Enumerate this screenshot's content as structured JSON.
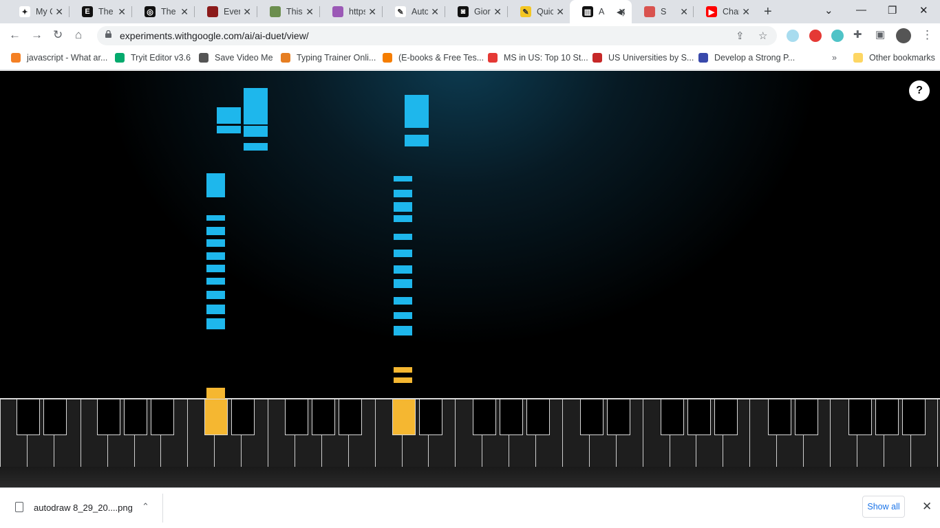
{
  "browser": {
    "tabs": [
      {
        "title": "My C",
        "favicon_color": "#fff",
        "favicon_text": "✦",
        "favicon_fg": "#222"
      },
      {
        "title": "The I",
        "favicon_color": "#111",
        "favicon_text": "E",
        "favicon_fg": "#fff"
      },
      {
        "title": "The I",
        "favicon_color": "#111",
        "favicon_text": "◎",
        "favicon_fg": "#fff"
      },
      {
        "title": "Even",
        "favicon_color": "#8b1a1a",
        "favicon_text": "",
        "favicon_fg": "#fff"
      },
      {
        "title": "This I",
        "favicon_color": "#6b8e4e",
        "favicon_text": "",
        "favicon_fg": "#fff"
      },
      {
        "title": "https",
        "favicon_color": "#9b59b6",
        "favicon_text": "",
        "favicon_fg": "#fff"
      },
      {
        "title": "Auto",
        "favicon_color": "#fff",
        "favicon_text": "✎",
        "favicon_fg": "#333"
      },
      {
        "title": "Giorg",
        "favicon_color": "#111",
        "favicon_text": "◙",
        "favicon_fg": "#fff"
      },
      {
        "title": "Quic",
        "favicon_color": "#f3c623",
        "favicon_text": "✎",
        "favicon_fg": "#333"
      },
      {
        "title": "A",
        "favicon_color": "#111",
        "favicon_text": "▥",
        "favicon_fg": "#fff"
      },
      {
        "title": "S",
        "favicon_color": "#d9534f",
        "favicon_text": "",
        "favicon_fg": "#fff"
      },
      {
        "title": "Chan",
        "favicon_color": "#ff0000",
        "favicon_text": "▶",
        "favicon_fg": "#fff"
      }
    ],
    "active_tab_index": 9,
    "url": "experiments.withgoogle.com/ai/ai-duet/view/",
    "bookmarks": [
      {
        "label": "javascript - What ar...",
        "color": "#f48024"
      },
      {
        "label": "Tryit Editor v3.6",
        "color": "#04aa6d"
      },
      {
        "label": "Save Video Me",
        "color": "#555555"
      },
      {
        "label": "Typing Trainer Onli...",
        "color": "#e67e22"
      },
      {
        "label": "(E-books & Free Tes...",
        "color": "#f57d00"
      },
      {
        "label": "MS in US: Top 10 St...",
        "color": "#e53935"
      },
      {
        "label": "US Universities by S...",
        "color": "#c62828"
      },
      {
        "label": "Develop a Strong P...",
        "color": "#3949ab"
      }
    ],
    "other_bookmarks": "Other bookmarks"
  },
  "app": {
    "help_label": "?",
    "note_color": "#1eb7ec",
    "active_color": "#f5b731"
  },
  "download": {
    "filename": "autodraw 8_29_20....png",
    "show_all": "Show all"
  }
}
